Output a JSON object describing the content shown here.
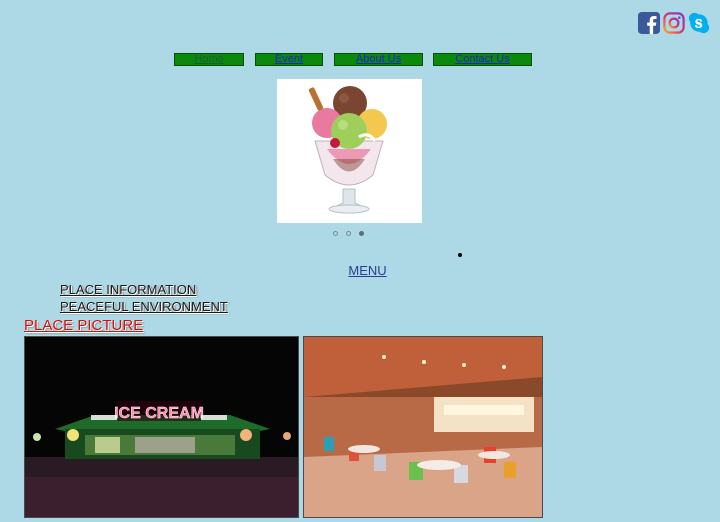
{
  "social": {
    "icons": [
      "facebook-icon",
      "instagram-icon",
      "skype-icon"
    ]
  },
  "nav": {
    "items": [
      {
        "label": "Home"
      },
      {
        "label": "Event"
      },
      {
        "label": "About Us"
      },
      {
        "label": "Contact Us"
      }
    ]
  },
  "carousel": {
    "image": "ice-cream-sundae",
    "slide_count": 3,
    "active_slide": 3
  },
  "menu": {
    "label": "MENU"
  },
  "info_links": [
    "PLACE INFORMATION",
    "PEACEFUL ENVIRONMENT"
  ],
  "place_heading": "PLACE PICTURE",
  "photos": {
    "left_sign": "ICE CREAM"
  },
  "colors": {
    "background": "#add8e6",
    "nav_button": "#0a8a0a",
    "heading_red": "#d01010"
  }
}
